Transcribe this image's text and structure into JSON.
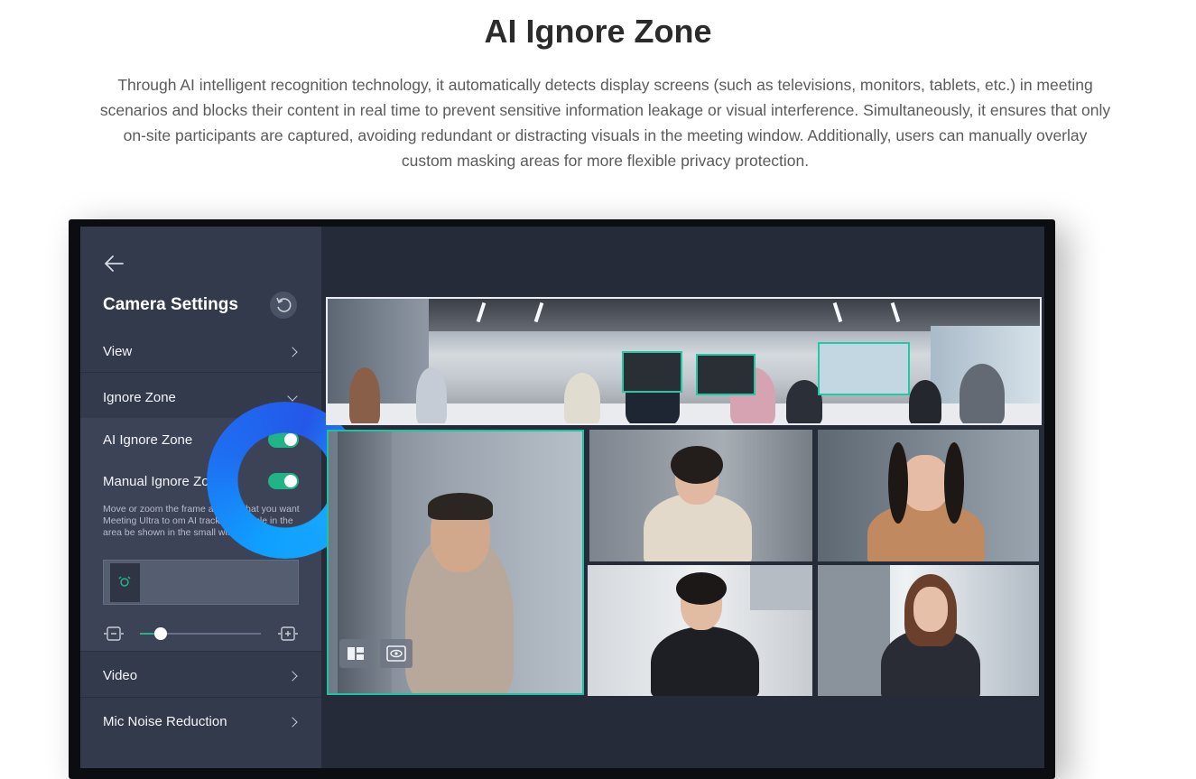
{
  "hero": {
    "title": "AI Ignore Zone",
    "description": "Through AI intelligent recognition technology, it automatically detects display screens (such as televisions, monitors, tablets, etc.) in meeting scenarios and blocks their content in real time to prevent sensitive information leakage or visual interference. Simultaneously, it ensures that only on-site participants are captured, avoiding redundant or distracting visuals in the meeting window. Additionally, users can manually overlay custom masking areas for more flexible privacy protection."
  },
  "panel": {
    "title": "Camera Settings",
    "items": [
      {
        "label": "View"
      },
      {
        "label": "Ignore Zone"
      },
      {
        "label": "Video"
      },
      {
        "label": "Mic Noise Reduction"
      }
    ],
    "ai_ignore_zone": {
      "label": "AI Ignore Zone",
      "enabled": true
    },
    "manual_ignore_zone": {
      "label": "Manual Ignore Zo",
      "enabled": true
    },
    "help_text": "Move or zoom the frame         an area that you want Meeting Ultra to      om AI tracking. People in the area         be shown in the small window.",
    "zoom_level": 0.18
  },
  "colors": {
    "accent": "#20b486",
    "frame_highlight": "#25c7a5",
    "ring": "#1e6ff2"
  },
  "icons": {
    "back": "arrow-left-icon",
    "reset": "reset-icon",
    "zoom_out": "zoom-out-icon",
    "zoom_in": "zoom-in-icon",
    "layout": "layout-grid-icon",
    "privacy": "eye-privacy-icon"
  }
}
